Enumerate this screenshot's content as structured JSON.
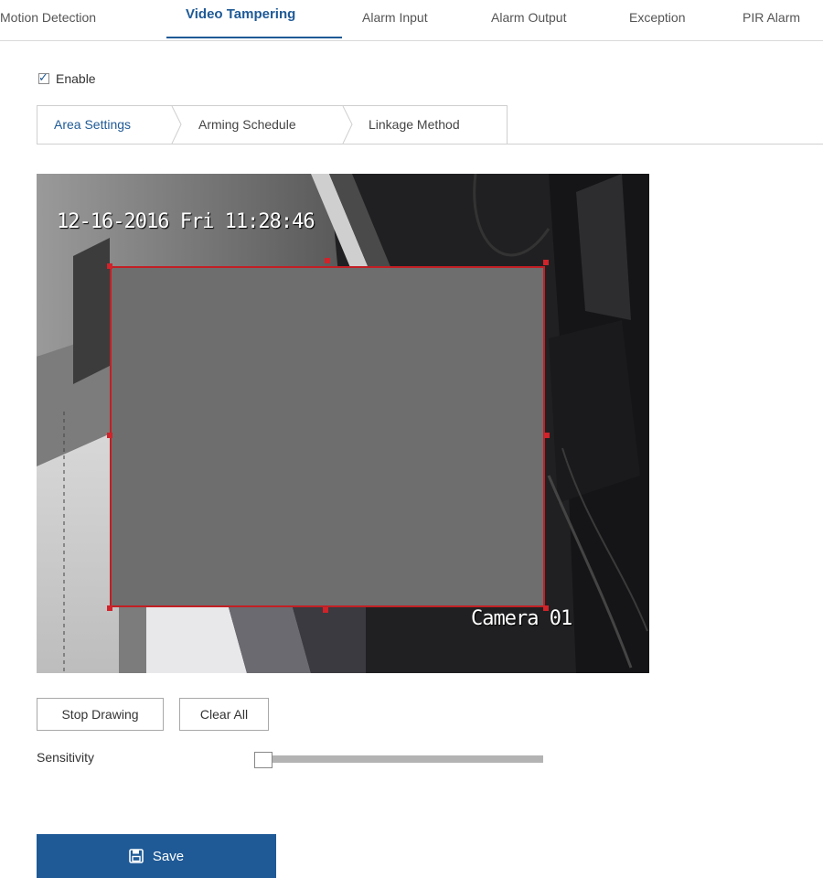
{
  "top_tabs": [
    {
      "label": "Motion Detection",
      "active": false
    },
    {
      "label": "Video Tampering",
      "active": true
    },
    {
      "label": "Alarm Input",
      "active": false
    },
    {
      "label": "Alarm Output",
      "active": false
    },
    {
      "label": "Exception",
      "active": false
    },
    {
      "label": "PIR Alarm",
      "active": false
    }
  ],
  "enable": {
    "label": "Enable",
    "checked": true
  },
  "sub_tabs": [
    {
      "label": "Area Settings",
      "active": true
    },
    {
      "label": "Arming Schedule",
      "active": false
    },
    {
      "label": "Linkage Method",
      "active": false
    }
  ],
  "video": {
    "osd_datetime": "12-16-2016 Fri 11:28:46",
    "osd_camera": "Camera 01"
  },
  "buttons": {
    "stop_drawing": "Stop Drawing",
    "clear_all": "Clear All"
  },
  "sensitivity": {
    "label": "Sensitivity",
    "value_fraction": 0.0
  },
  "save": {
    "label": "Save",
    "icon": "floppy-disk-icon"
  },
  "colors": {
    "accent": "#1f5a96",
    "area_border": "#c21f24",
    "area_fill": "#6e6e6e"
  }
}
